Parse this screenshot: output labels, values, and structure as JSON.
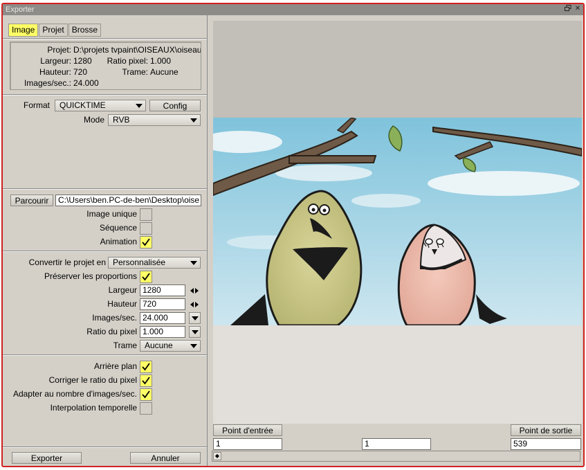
{
  "window": {
    "title": "Exporter",
    "restore_icon": "restore-window-icon",
    "close_icon": "close-icon"
  },
  "tabs": [
    "Image",
    "Projet",
    "Brosse"
  ],
  "active_tab": "Image",
  "info": {
    "projet_label": "Projet:",
    "projet_value": "D:\\projets tvpaint\\OISEAUX\\oiseau",
    "largeur_label": "Largeur:",
    "largeur_value": "1280",
    "ratio_label": "Ratio pixel:",
    "ratio_value": "1.000",
    "hauteur_label": "Hauteur:",
    "hauteur_value": "720",
    "trame_label": "Trame:",
    "trame_value": "Aucune",
    "ips_label": "Images/sec.:",
    "ips_value": "24.000"
  },
  "format": {
    "label": "Format",
    "value": "QUICKTIME",
    "config_label": "Config",
    "mode_label": "Mode",
    "mode_value": "RVB"
  },
  "output": {
    "browse_label": "Parcourir",
    "path": "C:\\Users\\ben.PC-de-ben\\Desktop\\oise",
    "image_unique_label": "Image unique",
    "image_unique_checked": false,
    "sequence_label": "Séquence",
    "sequence_checked": false,
    "animation_label": "Animation",
    "animation_checked": true
  },
  "convert": {
    "label": "Convertir le projet en",
    "value": "Personnalisée",
    "preserve_label": "Préserver les proportions",
    "preserve_checked": true,
    "largeur_label": "Largeur",
    "largeur_value": "1280",
    "hauteur_label": "Hauteur",
    "hauteur_value": "720",
    "ips_label": "Images/sec.",
    "ips_value": "24.000",
    "ratio_label": "Ratio du pixel",
    "ratio_value": "1.000",
    "trame_label": "Trame",
    "trame_value": "Aucune"
  },
  "options": {
    "arriere_plan_label": "Arrière plan",
    "arriere_plan_checked": true,
    "corriger_label": "Corriger le ratio du pixel",
    "corriger_checked": true,
    "adapter_label": "Adapter au nombre d'images/sec.",
    "adapter_checked": true,
    "interpolation_label": "Interpolation temporelle",
    "interpolation_checked": false
  },
  "footer": {
    "export_label": "Exporter",
    "cancel_label": "Annuler"
  },
  "timeline": {
    "in_label": "Point d'entrée",
    "out_label": "Point de sortie",
    "in_value": "1",
    "current_value": "1",
    "out_value": "539"
  },
  "colors": {
    "highlight": "#ffff66",
    "panel": "#d4d0c8",
    "window_border": "#d21f1f"
  }
}
